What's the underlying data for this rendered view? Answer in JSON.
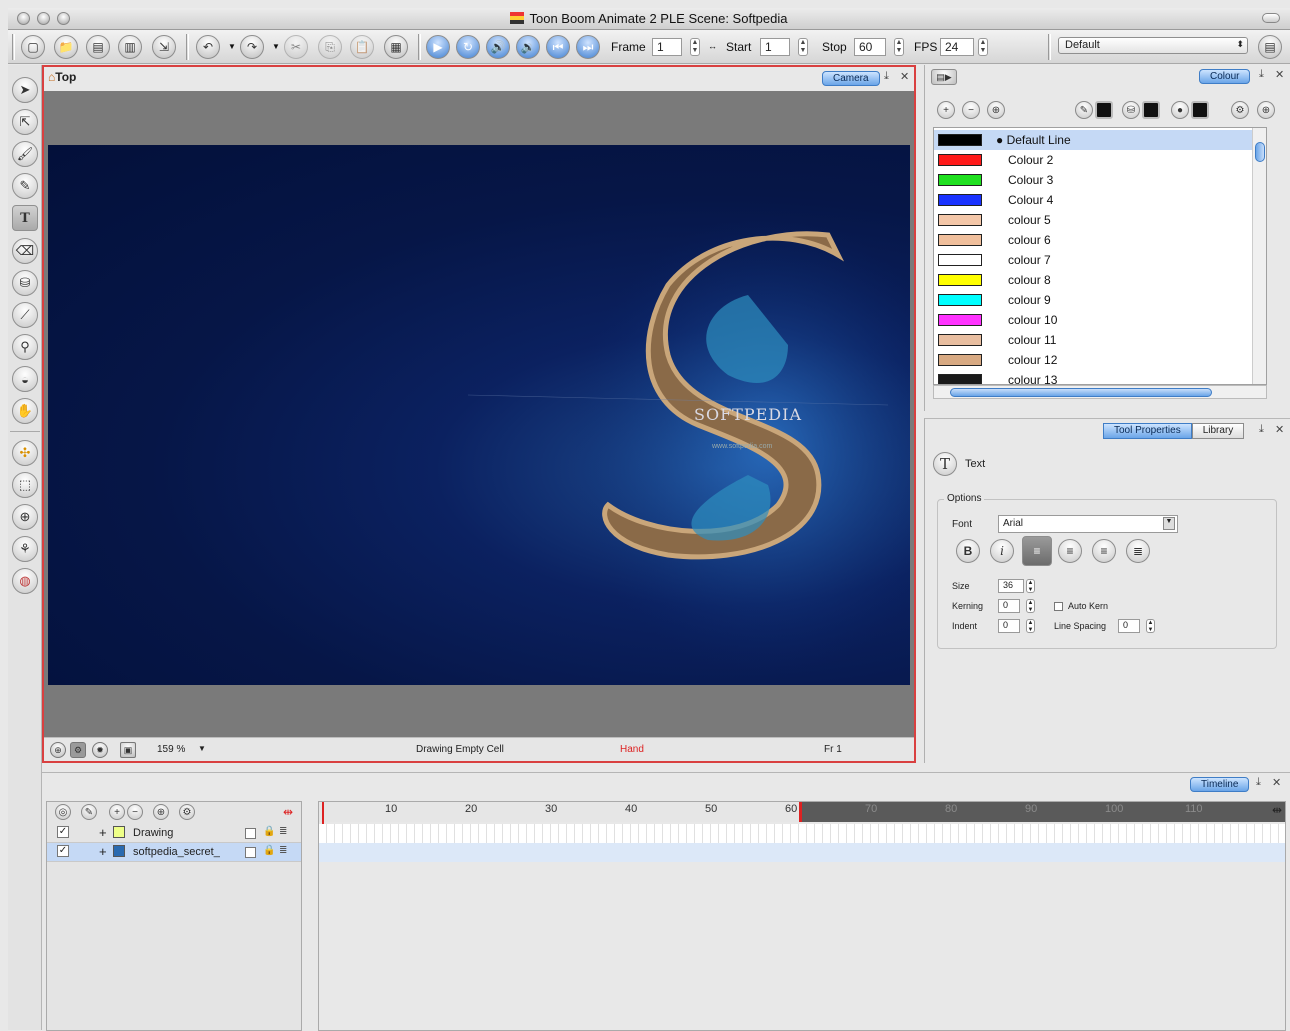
{
  "window": {
    "title": "Toon Boom Animate 2 PLE Scene: Softpedia"
  },
  "toolbar": {
    "frame_label": "Frame",
    "frame_value": "1",
    "start_label": "Start",
    "start_value": "1",
    "stop_label": "Stop",
    "stop_value": "60",
    "fps_label": "FPS",
    "fps_value": "24",
    "workspace_value": "Default"
  },
  "camera_view": {
    "title": "Top",
    "tab_label": "Camera",
    "zoom": "159 %",
    "status_cell": "Drawing Empty Cell",
    "status_tool": "Hand",
    "status_frame": "Fr 1",
    "stage_text": "SOFTPEDIA",
    "stage_url": "www.softpedia.com"
  },
  "colour_panel": {
    "tab_label": "Colour",
    "colours": [
      {
        "name": "Default Line",
        "hex": "#000000",
        "selected": true
      },
      {
        "name": "Colour 2",
        "hex": "#ff1a1a"
      },
      {
        "name": "Colour 3",
        "hex": "#20e020"
      },
      {
        "name": "Colour 4",
        "hex": "#1a33ff"
      },
      {
        "name": "colour 5",
        "hex": "#f4c7a8"
      },
      {
        "name": "colour 6",
        "hex": "#f0bf9c"
      },
      {
        "name": "colour 7",
        "hex": "#ffffff"
      },
      {
        "name": "colour 8",
        "hex": "#ffff00"
      },
      {
        "name": "colour 9",
        "hex": "#00ffff"
      },
      {
        "name": "colour 10",
        "hex": "#ff33ff"
      },
      {
        "name": "colour 11",
        "hex": "#e8bea0"
      },
      {
        "name": "colour 12",
        "hex": "#d7a982"
      },
      {
        "name": "colour 13",
        "hex": "#1a1a1a"
      }
    ]
  },
  "tool_properties": {
    "tab_active": "Tool Properties",
    "tab_other": "Library",
    "tool_name": "Text",
    "options_label": "Options",
    "font_label": "Font",
    "font_value": "Arial",
    "size_label": "Size",
    "size_value": "36",
    "kerning_label": "Kerning",
    "kerning_value": "0",
    "indent_label": "Indent",
    "indent_value": "0",
    "auto_kern_label": "Auto Kern",
    "line_spacing_label": "Line Spacing",
    "line_spacing_value": "0"
  },
  "timeline": {
    "tab_label": "Timeline",
    "layers": [
      {
        "name": "Drawing",
        "checked": true,
        "selected": false
      },
      {
        "name": "softpedia_secret_",
        "checked": true,
        "selected": true
      }
    ],
    "ruler_numbers": [
      "10",
      "20",
      "30",
      "40",
      "50",
      "60",
      "70",
      "80",
      "90",
      "100",
      "110"
    ]
  }
}
